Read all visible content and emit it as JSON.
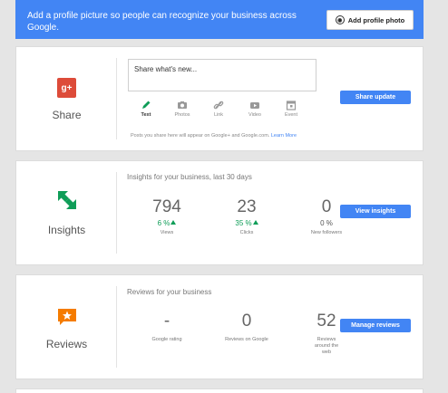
{
  "banner": {
    "text": "Add a profile picture so people can recognize your business across Google.",
    "button_label": "Add profile photo"
  },
  "share": {
    "label": "Share",
    "logo_text": "g+",
    "placeholder": "Share what's new...",
    "tools": [
      {
        "label": "Text",
        "icon": "pencil-icon"
      },
      {
        "label": "Photos",
        "icon": "camera-icon"
      },
      {
        "label": "Link",
        "icon": "link-icon"
      },
      {
        "label": "Video",
        "icon": "video-icon"
      },
      {
        "label": "Event",
        "icon": "calendar-icon"
      }
    ],
    "note": "Posts you share here will appear on Google+ and Google.com.",
    "learn_more": "Learn More",
    "button_label": "Share update"
  },
  "insights": {
    "label": "Insights",
    "title": "Insights for your business, last 30 days",
    "button_label": "View insights",
    "stats": [
      {
        "value": "794",
        "change": "6 %",
        "label": "Views"
      },
      {
        "value": "23",
        "change": "35 %",
        "label": "Clicks"
      },
      {
        "value": "0",
        "change": "0 %",
        "label": "New followers"
      }
    ]
  },
  "reviews": {
    "label": "Reviews",
    "title": "Reviews for your business",
    "button_label": "Manage reviews",
    "stats": [
      {
        "value": "-",
        "label": "Google rating"
      },
      {
        "value": "0",
        "label": "Reviews on Google"
      },
      {
        "value": "52",
        "label": "Reviews around the web"
      }
    ]
  },
  "colors": {
    "accent": "#4285f4",
    "gplus": "#dd4b39",
    "insights_green": "#0f9d58",
    "reviews_orange": "#f57c00",
    "background": "#e5e5e5"
  }
}
